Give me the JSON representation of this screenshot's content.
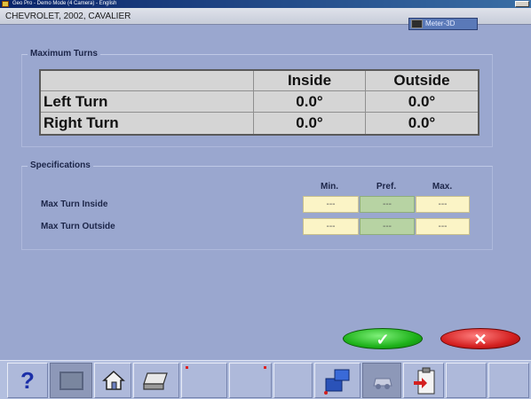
{
  "window": {
    "title": "Geo Pro - Demo Mode (4 Camera) - English"
  },
  "header": {
    "vehicle": "CHEVROLET, 2002, CAVALIER",
    "meter_label": "Meter-3D"
  },
  "max_turns": {
    "group_label": "Maximum Turns",
    "columns": [
      "Inside",
      "Outside"
    ],
    "rows": [
      {
        "label": "Left Turn",
        "inside": "0.0°",
        "outside": "0.0°"
      },
      {
        "label": "Right Turn",
        "inside": "0.0°",
        "outside": "0.0°"
      }
    ]
  },
  "specifications": {
    "group_label": "Specifications",
    "columns": [
      "Min.",
      "Pref.",
      "Max."
    ],
    "rows": [
      {
        "label": "Max Turn Inside",
        "min": "---",
        "pref": "---",
        "max": "---"
      },
      {
        "label": "Max Turn Outside",
        "min": "---",
        "pref": "---",
        "max": "---"
      }
    ]
  },
  "actions": {
    "ok": "✓",
    "cancel": "✕"
  },
  "toolbar": {
    "help": "?"
  }
}
